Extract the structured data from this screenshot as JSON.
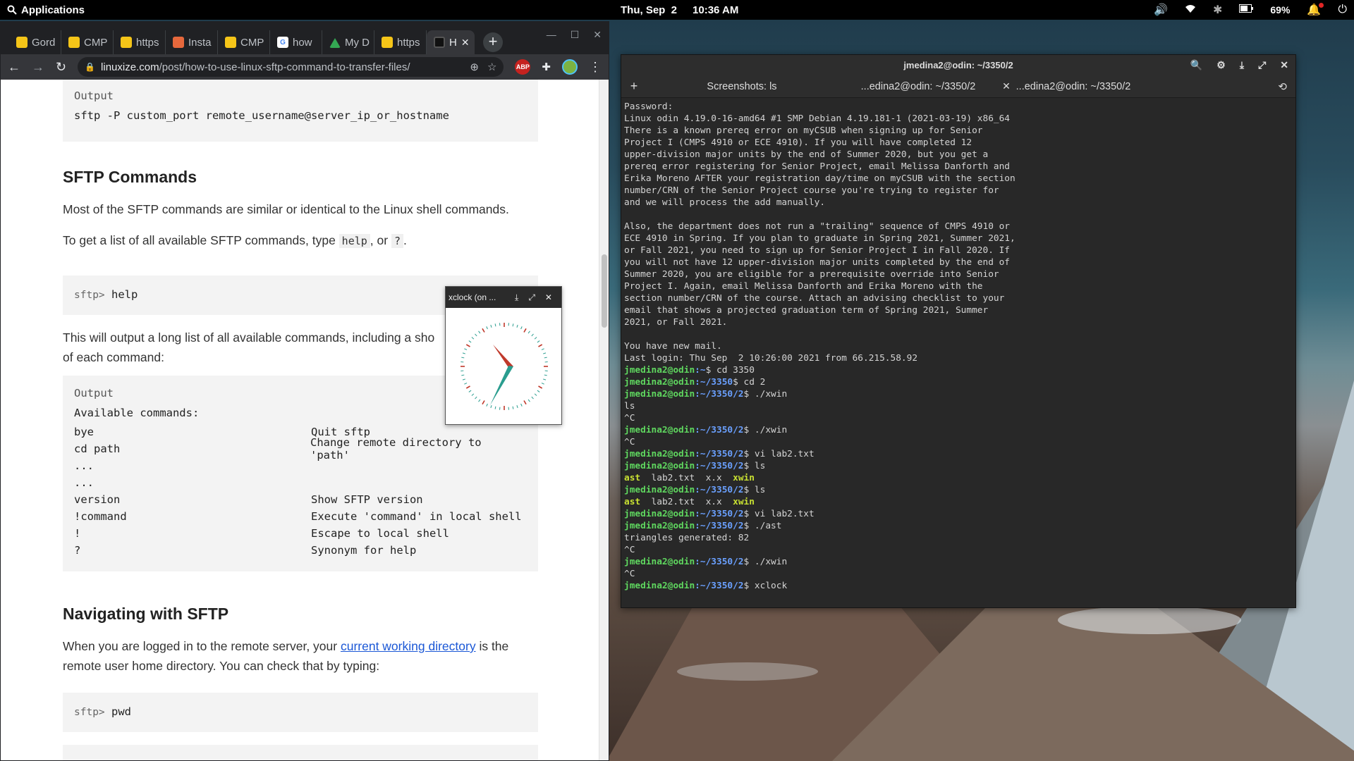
{
  "top_panel": {
    "applications_label": "Applications",
    "date": "Thu, Sep  2",
    "time": "10:36 AM",
    "battery": "69%"
  },
  "browser": {
    "tabs": [
      {
        "label": "Gord",
        "icon": "csub-icon"
      },
      {
        "label": "CMP",
        "icon": "csub-icon"
      },
      {
        "label": "https",
        "icon": "csub-icon"
      },
      {
        "label": "Insta",
        "icon": "insta-icon"
      },
      {
        "label": "CMP",
        "icon": "csub-icon"
      },
      {
        "label": "how",
        "icon": "google-icon"
      },
      {
        "label": "My D",
        "icon": "drive-icon"
      },
      {
        "label": "https",
        "icon": "csub-icon"
      },
      {
        "label": "H",
        "icon": "dark-icon"
      }
    ],
    "url_host": "linuxize.com",
    "url_path": "/post/how-to-use-linux-sftp-command-to-transfer-files/",
    "ext_badge": "ABP"
  },
  "page": {
    "output_label_1": "Output",
    "code_port": "sftp -P custom_port remote_username@server_ip_or_hostname",
    "heading_commands": "SFTP Commands",
    "p1": "Most of the SFTP commands are similar or identical to the Linux shell commands.",
    "p2_pre": "To get a list of all available SFTP commands, type ",
    "p2_code1": "help",
    "p2_mid": ", or ",
    "p2_code2": "?",
    "p2_post": ".",
    "prompt": "sftp>",
    "cmd_help": "help",
    "p3_line1": "This will output a long list of all available commands, including a sho",
    "p3_line2": "of each command:",
    "output_label_2": "Output",
    "available": "Available commands:",
    "commands": [
      {
        "cmd": "bye",
        "desc": "Quit sftp"
      },
      {
        "cmd": "cd path",
        "desc": "Change remote directory to 'path'"
      },
      {
        "cmd": "...",
        "desc": ""
      },
      {
        "cmd": "...",
        "desc": ""
      },
      {
        "cmd": "version",
        "desc": "Show SFTP version"
      },
      {
        "cmd": "!command",
        "desc": "Execute 'command' in local shell"
      },
      {
        "cmd": "!",
        "desc": "Escape to local shell"
      },
      {
        "cmd": "?",
        "desc": "Synonym for help"
      }
    ],
    "heading_nav": "Navigating with SFTP",
    "p4_pre": "When you are logged in to the remote server, your ",
    "p4_link": "current working directory",
    "p4_post": " is the",
    "p4_line2": "remote user home directory. You can check that by typing:",
    "cmd_pwd": "pwd"
  },
  "xclock": {
    "title": "xclock (on ..."
  },
  "terminal": {
    "title": "jmedina2@odin: ~/3350/2",
    "tabs": [
      "Screenshots: ls",
      "...edina2@odin: ~/3350/2",
      "...edina2@odin: ~/3350/2"
    ],
    "lines": [
      {
        "t": "Password:"
      },
      {
        "t": "Linux odin 4.19.0-16-amd64 #1 SMP Debian 4.19.181-1 (2021-03-19) x86_64"
      },
      {
        "t": "There is a known prereq error on myCSUB when signing up for Senior"
      },
      {
        "t": "Project I (CMPS 4910 or ECE 4910). If you will have completed 12"
      },
      {
        "t": "upper-division major units by the end of Summer 2020, but you get a"
      },
      {
        "t": "prereq error registering for Senior Project, email Melissa Danforth and"
      },
      {
        "t": "Erika Moreno AFTER your registration day/time on myCSUB with the section"
      },
      {
        "t": "number/CRN of the Senior Project course you're trying to register for"
      },
      {
        "t": "and we will process the add manually."
      },
      {
        "t": ""
      },
      {
        "t": "Also, the department does not run a \"trailing\" sequence of CMPS 4910 or"
      },
      {
        "t": "ECE 4910 in Spring. If you plan to graduate in Spring 2021, Summer 2021,"
      },
      {
        "t": "or Fall 2021, you need to sign up for Senior Project I in Fall 2020. If"
      },
      {
        "t": "you will not have 12 upper-division major units completed by the end of"
      },
      {
        "t": "Summer 2020, you are eligible for a prerequisite override into Senior"
      },
      {
        "t": "Project I. Again, email Melissa Danforth and Erika Moreno with the"
      },
      {
        "t": "section number/CRN of the course. Attach an advising checklist to your"
      },
      {
        "t": "email that shows a projected graduation term of Spring 2021, Summer"
      },
      {
        "t": "2021, or Fall 2021."
      },
      {
        "t": ""
      },
      {
        "t": "You have new mail."
      },
      {
        "t": "Last login: Thu Sep  2 10:26:00 2021 from 66.215.58.92"
      },
      {
        "u": "jmedina2@odin",
        "p": ":~",
        "c": "$ cd 3350"
      },
      {
        "u": "jmedina2@odin",
        "p": ":~/3350",
        "c": "$ cd 2"
      },
      {
        "u": "jmedina2@odin",
        "p": ":~/3350/2",
        "c": "$ ./xwin"
      },
      {
        "t": "ls"
      },
      {
        "t": "^C"
      },
      {
        "u": "jmedina2@odin",
        "p": ":~/3350/2",
        "c": "$ ./xwin"
      },
      {
        "t": "^C"
      },
      {
        "u": "jmedina2@odin",
        "p": ":~/3350/2",
        "c": "$ vi lab2.txt"
      },
      {
        "u": "jmedina2@odin",
        "p": ":~/3350/2",
        "c": "$ ls"
      },
      {
        "ls": [
          "ast",
          "lab2.txt",
          "x.x",
          "xwin"
        ]
      },
      {
        "u": "jmedina2@odin",
        "p": ":~/3350/2",
        "c": "$ ls"
      },
      {
        "ls": [
          "ast",
          "lab2.txt",
          "x.x",
          "xwin"
        ]
      },
      {
        "u": "jmedina2@odin",
        "p": ":~/3350/2",
        "c": "$ vi lab2.txt"
      },
      {
        "u": "jmedina2@odin",
        "p": ":~/3350/2",
        "c": "$ ./ast"
      },
      {
        "t": "triangles generated: 82"
      },
      {
        "t": "^C"
      },
      {
        "u": "jmedina2@odin",
        "p": ":~/3350/2",
        "c": "$ ./xwin"
      },
      {
        "t": "^C"
      },
      {
        "u": "jmedina2@odin",
        "p": ":~/3350/2",
        "c": "$ xclock"
      }
    ]
  }
}
